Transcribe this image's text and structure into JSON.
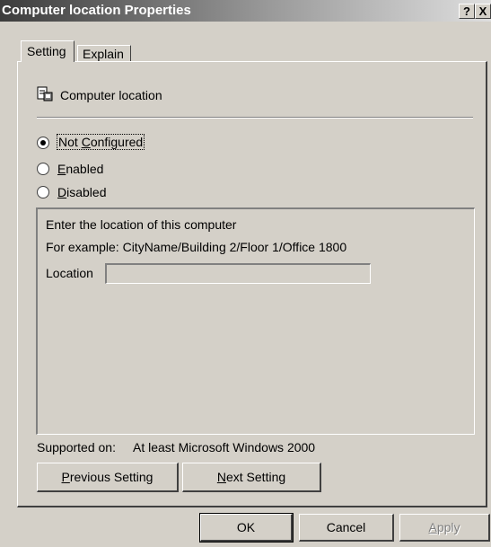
{
  "window": {
    "title": "Computer location Properties",
    "help_glyph": "?",
    "close_glyph": "X"
  },
  "tabs": [
    {
      "label": "Setting",
      "active": true
    },
    {
      "label": "Explain",
      "active": false
    }
  ],
  "policy": {
    "name": "Computer location",
    "icon": "policy-object-icon"
  },
  "options": {
    "not_configured": {
      "pre": "Not ",
      "key": "C",
      "post": "onfigured",
      "selected": true
    },
    "enabled": {
      "pre": "",
      "key": "E",
      "post": "nabled",
      "selected": false
    },
    "disabled": {
      "pre": "",
      "key": "D",
      "post": "isabled",
      "selected": false
    }
  },
  "options_panel": {
    "line1": "Enter the location of this computer",
    "line2": "For example: CityName/Building 2/Floor 1/Office 1800",
    "location_label": "Location",
    "location_value": ""
  },
  "supported_on": {
    "label": "Supported on:",
    "value": "At least Microsoft Windows 2000"
  },
  "nav_buttons": {
    "previous": {
      "key": "P",
      "post": "revious Setting"
    },
    "next": {
      "key": "N",
      "post": "ext Setting"
    }
  },
  "dialog_buttons": {
    "ok": "OK",
    "cancel": "Cancel",
    "apply": {
      "key": "A",
      "post": "pply"
    }
  }
}
